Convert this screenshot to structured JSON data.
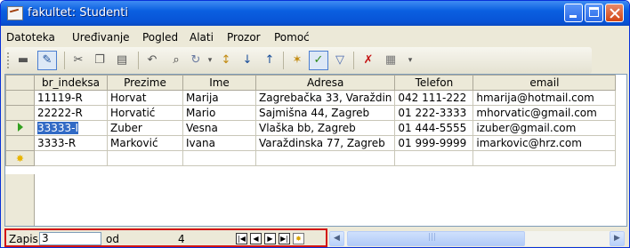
{
  "window": {
    "title": "fakultet: Studenti"
  },
  "menu": [
    "Datoteka",
    "Uređivanje",
    "Pogled",
    "Alati",
    "Prozor",
    "Pomoć"
  ],
  "toolbar_icons": [
    "view-icon",
    "design-icon",
    "cut-icon",
    "copy-icon",
    "paste-icon",
    "undo-icon",
    "find-icon",
    "hyperlink-icon",
    "sort-asc-icon",
    "sort-ascending-icon",
    "sort-descending-icon",
    "filter-selection-icon",
    "filter-form-icon",
    "apply-filter-icon",
    "delete-record-icon",
    "new-object-icon"
  ],
  "table": {
    "columns": [
      "br_indeksa",
      "Prezime",
      "Ime",
      "Adresa",
      "Telefon",
      "email"
    ],
    "rows": [
      [
        "11119-R",
        "Horvat",
        "Marija",
        "Zagrebačka 33, Varaždin",
        "042 111-222",
        "hmarija@hotmail.com"
      ],
      [
        "22222-R",
        "Horvatić",
        "Mario",
        "Sajmišna 44, Zagreb",
        "01 222-3333",
        "mhorvatic@gmail.com"
      ],
      [
        "33333-I",
        "Zuber",
        "Vesna",
        "Vlaška bb, Zagreb",
        "01 444-5555",
        "izuber@gmail.com"
      ],
      [
        "3333-R",
        "Marković",
        "Ivana",
        "Varaždinska 77, Zagreb",
        "01 999-9999",
        "imarkovic@hrz.com"
      ]
    ],
    "selected_row": 2
  },
  "navigation": {
    "record_label": "Zapis",
    "record_value": "3",
    "of_label": "od",
    "total": "4"
  },
  "colors": {
    "titlebar": "#0a5fe0",
    "selection": "#316ac5",
    "highlight_border": "#d21414"
  }
}
